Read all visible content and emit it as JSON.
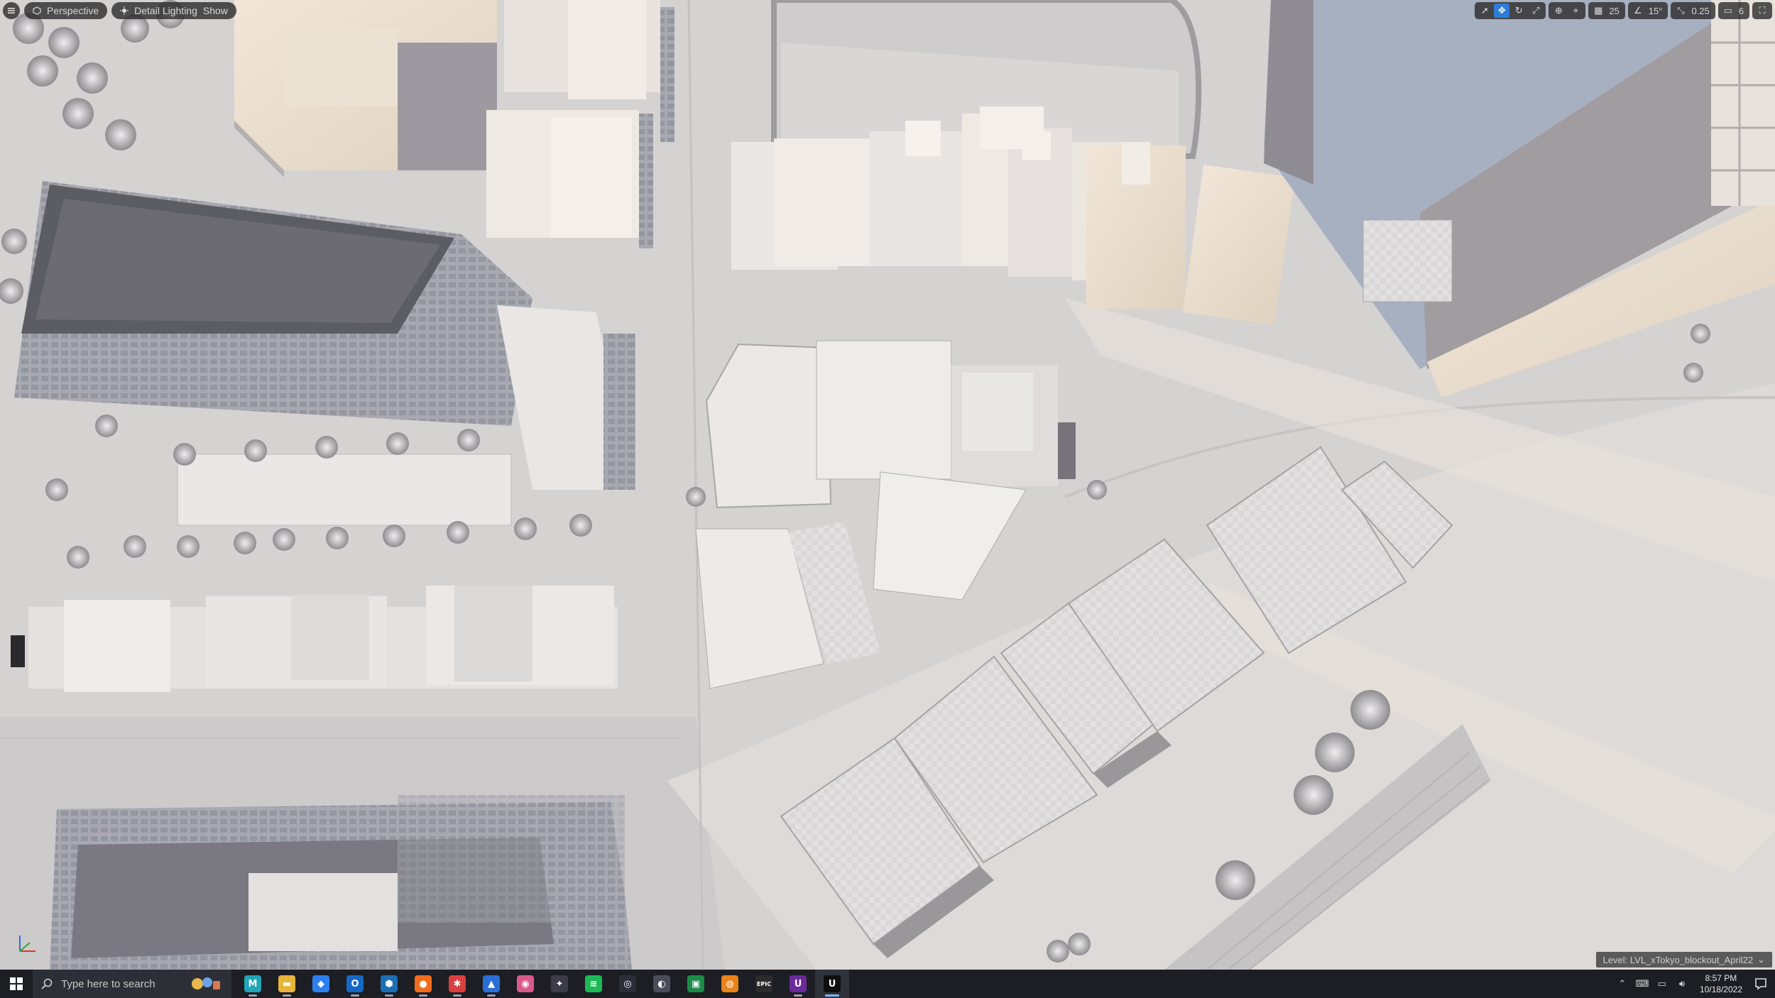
{
  "viewport": {
    "toolbar_left": {
      "menu_icon": "hamburger-icon",
      "perspective_label": "Perspective",
      "lighting_label": "Detail Lighting",
      "show_label": "Show"
    },
    "toolbar_right": {
      "tools": [
        "select-icon",
        "translate-icon",
        "rotate-icon",
        "scale-icon",
        "world-local-icon",
        "surface-snap-icon"
      ],
      "active_tool": "translate-icon",
      "grid_snap_value": "25",
      "rotation_snap_value": "15°",
      "scale_snap_value": "0.25",
      "camera_speed_value": "6",
      "maximize_icon": "maximize-icon"
    },
    "level_label": "Level: LVL_xTokyo_blockout_April22"
  },
  "taskbar": {
    "search_placeholder": "Type here to search",
    "apps": [
      {
        "name": "Maya",
        "glyph": "M",
        "color": "#1fa6b8",
        "open": true
      },
      {
        "name": "File Explorer",
        "glyph": "▬",
        "color": "#e8b43a",
        "open": true
      },
      {
        "name": "Defender",
        "glyph": "◆",
        "color": "#2d7ff0",
        "open": false
      },
      {
        "name": "Outlook",
        "glyph": "O",
        "color": "#1668c7",
        "open": true
      },
      {
        "name": "App",
        "glyph": "⬢",
        "color": "#1b6fb5",
        "open": true
      },
      {
        "name": "Firefox",
        "glyph": "●",
        "color": "#f06d1e",
        "open": true
      },
      {
        "name": "Substance",
        "glyph": "✱",
        "color": "#d93f3f",
        "open": true
      },
      {
        "name": "Photos",
        "glyph": "▲",
        "color": "#2a6fd8",
        "open": true
      },
      {
        "name": "Paint",
        "glyph": "◉",
        "color": "#d85a8a",
        "open": false
      },
      {
        "name": "DaVinci",
        "glyph": "✦",
        "color": "#3b3b4a",
        "open": false
      },
      {
        "name": "Spotify",
        "glyph": "≋",
        "color": "#1db954",
        "open": false
      },
      {
        "name": "Steam",
        "glyph": "◎",
        "color": "#2a2e38",
        "open": false
      },
      {
        "name": "App2",
        "glyph": "◐",
        "color": "#4a4e58",
        "open": false
      },
      {
        "name": "Photo",
        "glyph": "▣",
        "color": "#1e8a4a",
        "open": false
      },
      {
        "name": "Blender",
        "glyph": "◍",
        "color": "#e8821a",
        "open": false
      },
      {
        "name": "Epic",
        "glyph": "EPIC",
        "color": "#2b2b2b",
        "open": false
      },
      {
        "name": "Unreal Purple",
        "glyph": "U",
        "color": "#6a2a9a",
        "open": true
      },
      {
        "name": "Unreal Engine",
        "glyph": "U",
        "color": "#0e0e0e",
        "open": true,
        "active": true
      }
    ],
    "tray_icons": [
      "chevron-up-icon",
      "network-icon",
      "display-icon",
      "volume-icon"
    ],
    "time": "8:57 PM",
    "date": "10/18/2022"
  }
}
